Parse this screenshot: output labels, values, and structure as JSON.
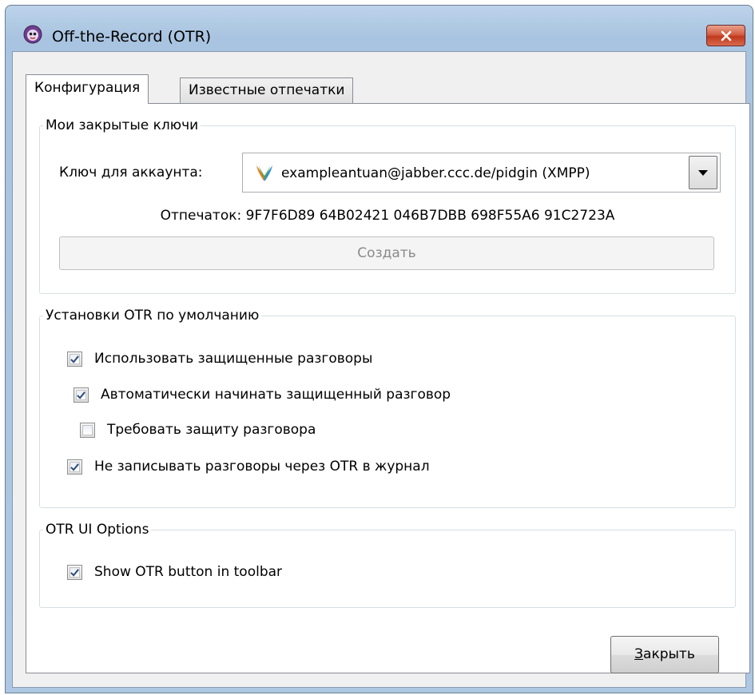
{
  "window": {
    "title": "Off-the-Record (OTR)"
  },
  "tabs": [
    {
      "label": "Конфигурация",
      "active": true
    },
    {
      "label": "Известные отпечатки",
      "active": false
    }
  ],
  "keys_group": {
    "title": "Мои закрытые ключи",
    "account_label": "Ключ для аккаунта:",
    "account_value": "exampleantuan@jabber.ccc.de/pidgin (XMPP)",
    "account_icon": "xmpp-protocol-icon",
    "fingerprint_text": "Отпечаток: 9F7F6D89 64B02421 046B7DBB 698F55A6 91C2723A",
    "create_button": "Создать"
  },
  "defaults_group": {
    "title": "Установки OTR по умолчанию",
    "options": [
      {
        "label": "Использовать защищенные разговоры",
        "checked": true
      },
      {
        "label": "Автоматически начинать защищенный разговор",
        "checked": true
      },
      {
        "label": "Требовать защиту разговора",
        "checked": false
      },
      {
        "label": "Не записывать разговоры через OTR в журнал",
        "checked": true
      }
    ]
  },
  "ui_group": {
    "title": "OTR UI Options",
    "options": [
      {
        "label": "Show OTR button in toolbar",
        "checked": true
      }
    ]
  },
  "footer": {
    "close_mnemonic": "З",
    "close_rest": "акрыть"
  },
  "colors": {
    "titlebar": "#bcd3ea",
    "close_red": "#c0391d",
    "check_mark": "#2a4a78"
  }
}
